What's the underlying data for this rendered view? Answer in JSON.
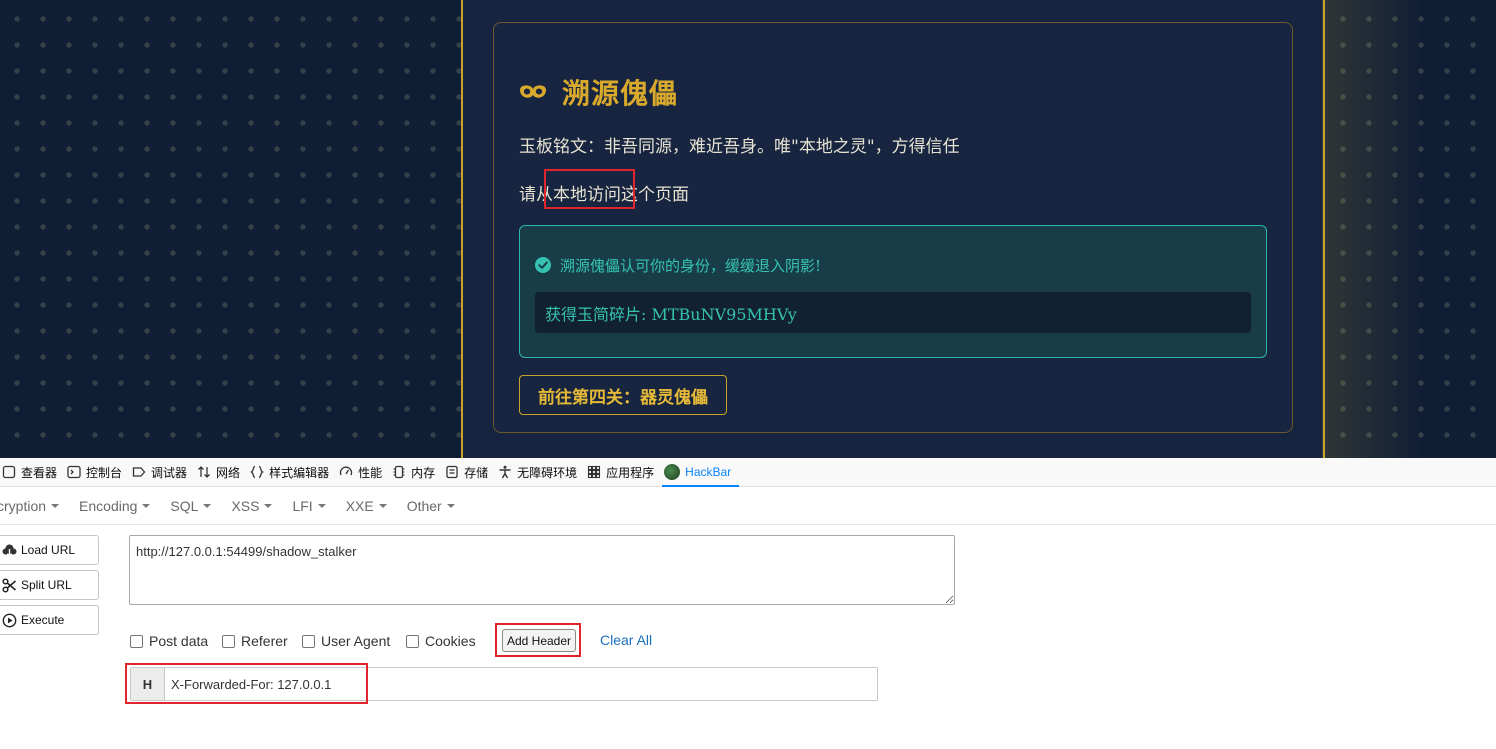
{
  "page": {
    "title": "溯源傀儡",
    "inscription": "玉板铭文：非吾同源，难近吾身。唯\"本地之灵\"，方得信任",
    "local_hint": "请从本地访问这个页面",
    "success_message": "溯源傀儡认可你的身份，缓缓退入阴影!",
    "fragment": "获得玉简碎片: MTBuNV95MHVy",
    "next_level_button": "前往第四关：器灵傀儡",
    "colors": {
      "gold": "#d9a92c",
      "teal": "#36c2b0",
      "highlight_red": "#e0262c"
    }
  },
  "devtools": {
    "tabs": [
      {
        "label": "查看器",
        "icon": "inspector-icon"
      },
      {
        "label": "控制台",
        "icon": "console-icon"
      },
      {
        "label": "调试器",
        "icon": "debugger-icon"
      },
      {
        "label": "网络",
        "icon": "network-icon"
      },
      {
        "label": "样式编辑器",
        "icon": "style-editor-icon"
      },
      {
        "label": "性能",
        "icon": "performance-icon"
      },
      {
        "label": "内存",
        "icon": "memory-icon"
      },
      {
        "label": "存储",
        "icon": "storage-icon"
      },
      {
        "label": "无障碍环境",
        "icon": "accessibility-icon"
      },
      {
        "label": "应用程序",
        "icon": "application-icon"
      },
      {
        "label": "HackBar",
        "icon": "hackbar-icon",
        "active": true
      }
    ]
  },
  "hackbar": {
    "menu": [
      "cryption",
      "Encoding",
      "SQL",
      "XSS",
      "LFI",
      "XXE",
      "Other"
    ],
    "load_url": "Load URL",
    "split_url": "Split URL",
    "execute": "Execute",
    "url": "http://127.0.0.1:54499/shadow_stalker",
    "options": [
      "Post data",
      "Referer",
      "User Agent",
      "Cookies"
    ],
    "add_header": "Add Header",
    "clear_all": "Clear All",
    "header_prefix": "H",
    "header_value": "X-Forwarded-For: 127.0.0.1"
  }
}
